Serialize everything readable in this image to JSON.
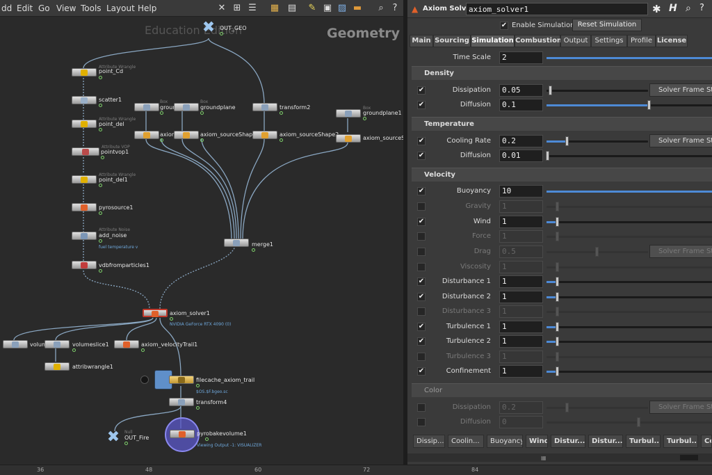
{
  "menubar": {
    "items": [
      "dd",
      "Edit",
      "Go",
      "View",
      "Tools",
      "Layout",
      "Help"
    ]
  },
  "network": {
    "context_title": "Geometry",
    "watermark": "Education Edition",
    "nodes": {
      "out_geo": {
        "label": "OUT_GEO"
      },
      "point_cd": {
        "type": "Attribute Wrangle",
        "label": "point_Cd"
      },
      "scatter1": {
        "label": "scatter1"
      },
      "point_del": {
        "type": "Attribute Wrangle",
        "label": "point_del"
      },
      "pointvop1": {
        "type": "Attribute VOP",
        "label": "pointvop1"
      },
      "point_del1": {
        "type": "Attribute Wrangle",
        "label": "point_del1"
      },
      "pyrosource1": {
        "label": "pyrosource1"
      },
      "add_noise": {
        "type": "Attribute Noise",
        "label": "add_noise",
        "sub": "fuel temperature v"
      },
      "vdbfromparticles1": {
        "label": "vdbfromparticles1"
      },
      "ground": {
        "type": "Box",
        "label": "ground"
      },
      "groundplane": {
        "type": "Box",
        "label": "groundplane"
      },
      "transform2": {
        "label": "transform2"
      },
      "groundplane1": {
        "type": "Box",
        "label": "groundplane1"
      },
      "axiom_a": {
        "label": "axiom"
      },
      "axiom_sourceshape1": {
        "label": "axiom_sourceShape1"
      },
      "axiom_sourceshape2": {
        "label": "axiom_sourceShape2"
      },
      "axiom_sourceshape3": {
        "label": "axiom_sourceSha"
      },
      "merge1": {
        "label": "merge1"
      },
      "axiom_solver1": {
        "label": "axiom_solver1",
        "sub": "NVIDIA GeForce RTX 4090 (0)"
      },
      "volume": {
        "label": "volume"
      },
      "volumeslice1": {
        "label": "volumeslice1"
      },
      "axiom_velocitytrail1": {
        "label": "axiom_velocityTrail1"
      },
      "attribwrangle1": {
        "label": "attribwrangle1"
      },
      "filecache": {
        "label": "filecache_axiom_trail",
        "sub": "$OS.$F.bgeo.sc"
      },
      "transform4": {
        "label": "transform4"
      },
      "out_fire": {
        "type": "Null",
        "label": "OUT_Fire"
      },
      "pyrobakevolume1": {
        "label": "pyrobakevolume1",
        "sub": "Viewing Output -1: VISUALIZER"
      }
    }
  },
  "timeline": {
    "ticks": [
      "36",
      "48",
      "60",
      "72",
      "84"
    ]
  },
  "params": {
    "node_type": "Axiom Solver",
    "node_name": "axiom_solver1",
    "enable_simulation": "Enable Simulation",
    "reset_simulation": "Reset Simulation",
    "tabs": [
      "Main",
      "Sourcing",
      "Simulation",
      "Combustion",
      "Output",
      "Settings",
      "Profile",
      "License"
    ],
    "active_tab": "Simulation",
    "time_scale": {
      "label": "Time Scale",
      "value": "2"
    },
    "sections": {
      "density": "Density",
      "temperature": "Temperature",
      "velocity": "Velocity",
      "color": "Color"
    },
    "solver_frame_step": "Solver Frame Step",
    "density": [
      {
        "label": "Dissipation",
        "value": "0.05",
        "checked": true
      },
      {
        "label": "Diffusion",
        "value": "0.1",
        "checked": true
      }
    ],
    "temperature": [
      {
        "label": "Cooling Rate",
        "value": "0.2",
        "checked": true
      },
      {
        "label": "Diffusion",
        "value": "0.01",
        "checked": true
      }
    ],
    "velocity": [
      {
        "label": "Buoyancy",
        "value": "10",
        "checked": true
      },
      {
        "label": "Gravity",
        "value": "1",
        "checked": false
      },
      {
        "label": "Wind",
        "value": "1",
        "checked": true
      },
      {
        "label": "Force",
        "value": "1",
        "checked": false
      },
      {
        "label": "Drag",
        "value": "0.5",
        "checked": false
      },
      {
        "label": "Viscosity",
        "value": "1",
        "checked": false
      },
      {
        "label": "Disturbance 1",
        "value": "1",
        "checked": true
      },
      {
        "label": "Disturbance 2",
        "value": "1",
        "checked": true
      },
      {
        "label": "Disturbance 3",
        "value": "1",
        "checked": false
      },
      {
        "label": "Turbulence 1",
        "value": "1",
        "checked": true
      },
      {
        "label": "Turbulence 2",
        "value": "1",
        "checked": true
      },
      {
        "label": "Turbulence 3",
        "value": "1",
        "checked": false
      },
      {
        "label": "Confinement",
        "value": "1",
        "checked": true
      }
    ],
    "color": [
      {
        "label": "Dissipation",
        "value": "0.2",
        "checked": false
      },
      {
        "label": "Diffusion",
        "value": "0",
        "checked": false
      }
    ],
    "bottom_tabs": [
      "Dissip...",
      "Coolin...",
      "Buoyancy",
      "Wind",
      "Distur...",
      "Distur...",
      "Turbul...",
      "Turbul...",
      "Co"
    ]
  },
  "colors": {
    "accent": "#4d8ad6",
    "wire": "#8aa7c2",
    "flag_green": "#7fd26b"
  }
}
